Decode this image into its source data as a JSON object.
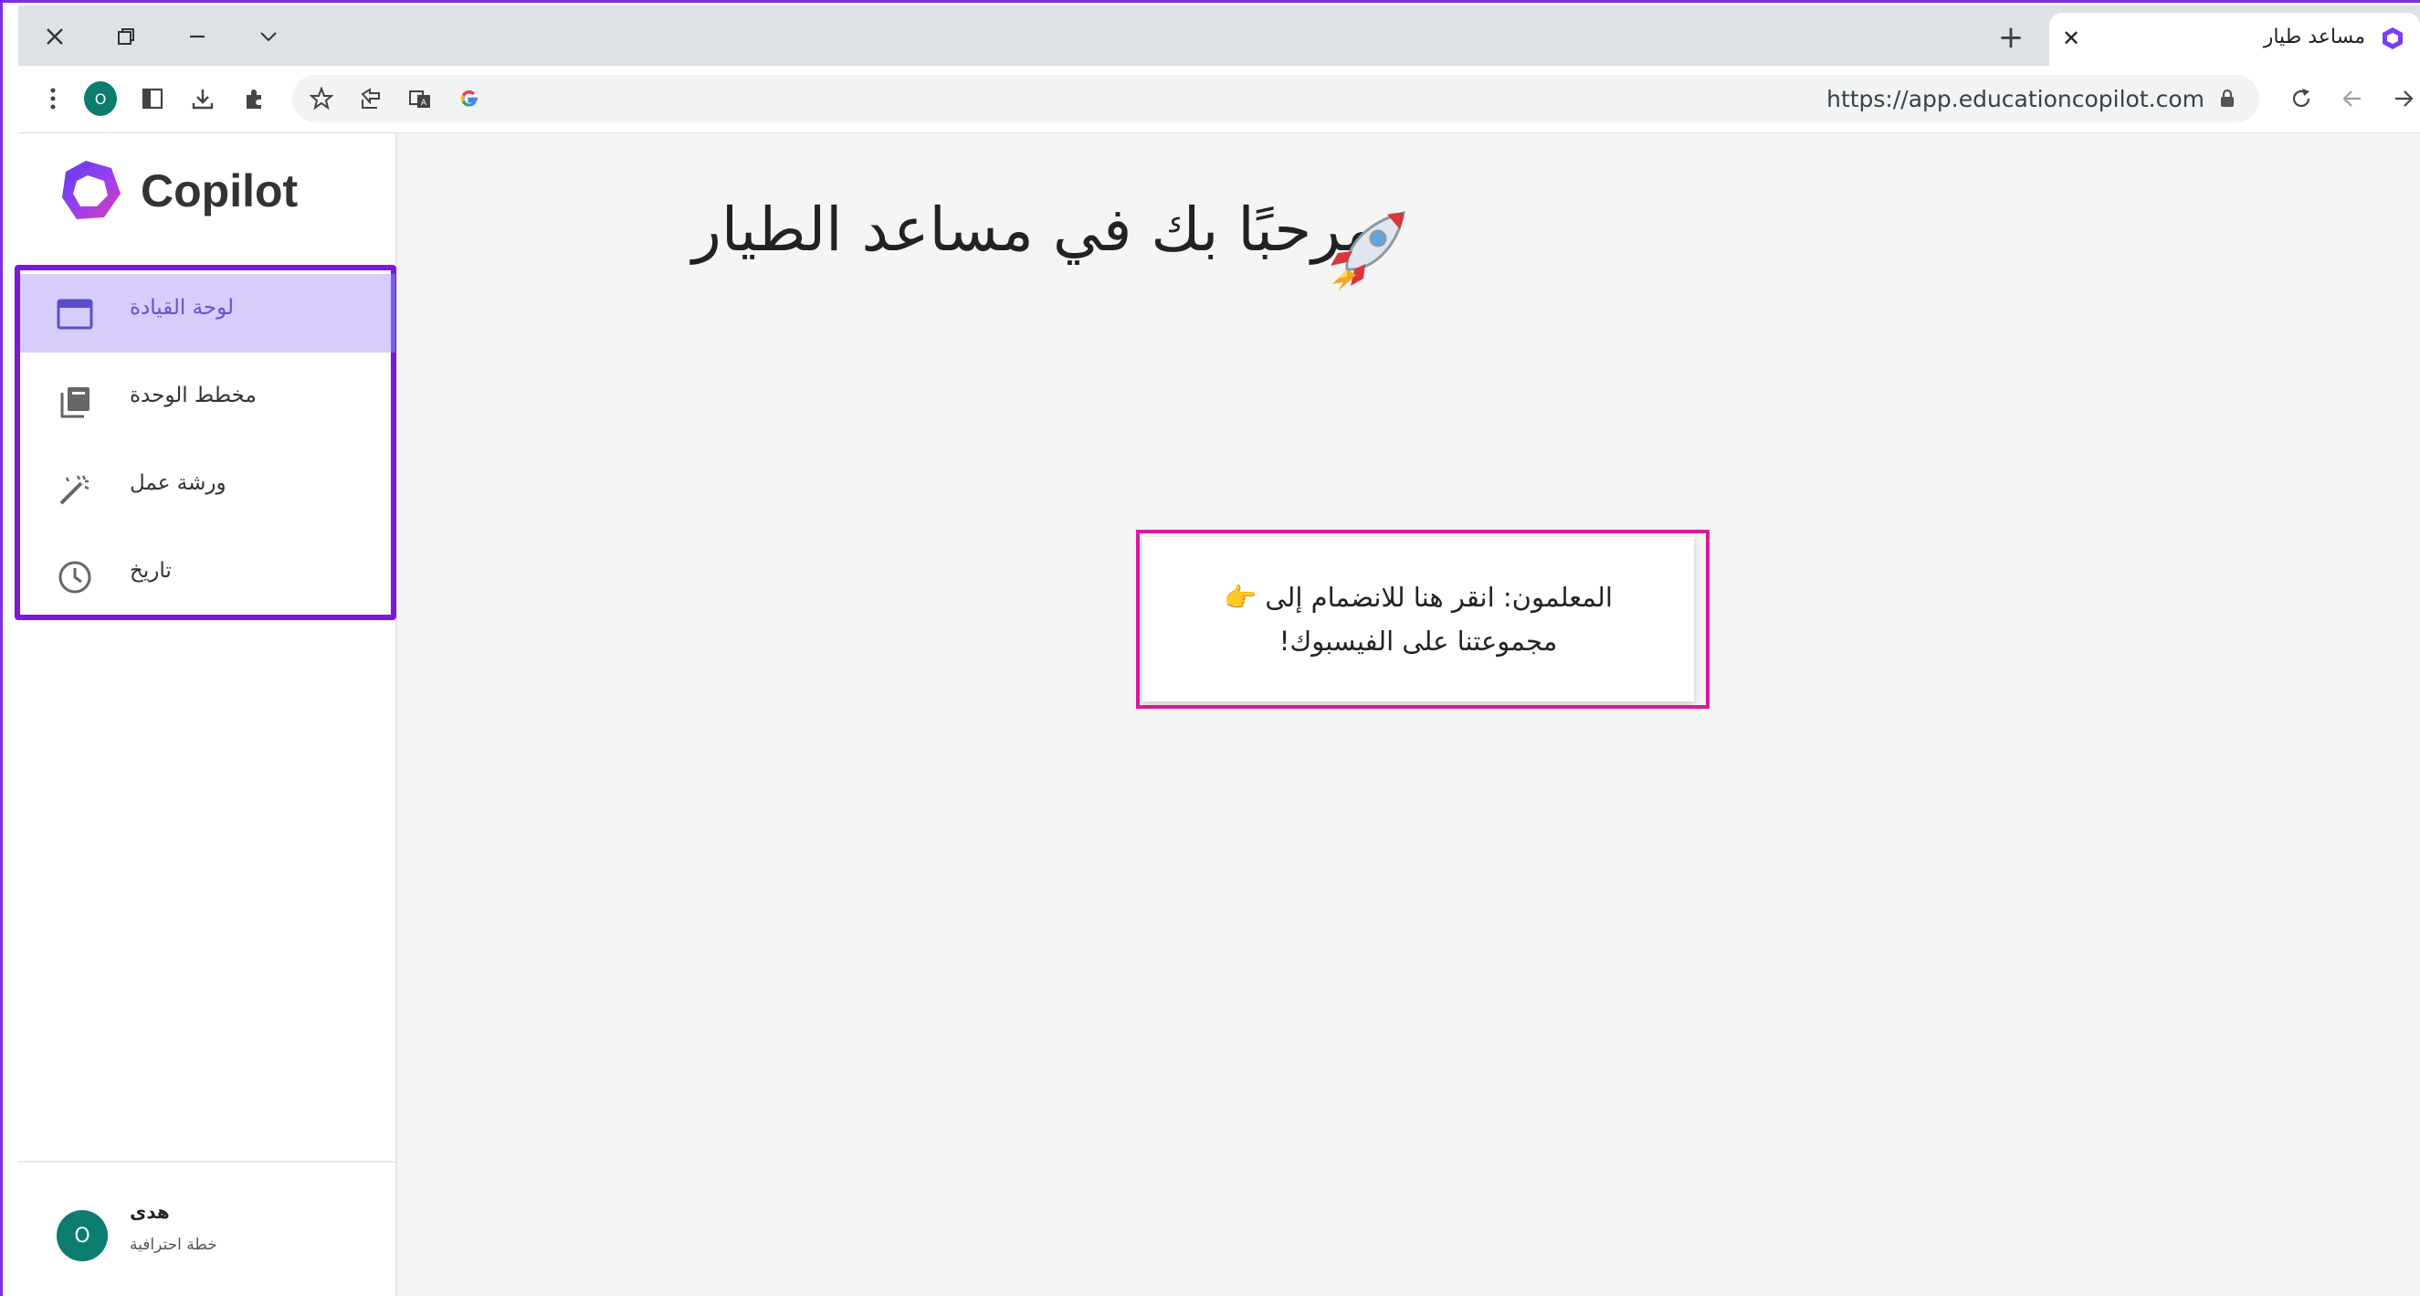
{
  "browser": {
    "tab_title": "مساعد طيار",
    "url": "https://app.educationcopilot.com",
    "profile_initial": "O"
  },
  "app": {
    "logo_text": "Copilot",
    "brand_color": "#7b5ce8"
  },
  "sidebar": {
    "items": [
      {
        "label": "لوحة القيادة",
        "icon": "dashboard-icon",
        "active": true
      },
      {
        "label": "مخطط الوحدة",
        "icon": "unit-planner-icon",
        "active": false
      },
      {
        "label": "ورشة عمل",
        "icon": "magic-wand-icon",
        "active": false
      },
      {
        "label": "تاريخ",
        "icon": "clock-icon",
        "active": false
      }
    ]
  },
  "user": {
    "initial": "O",
    "name": "هدى",
    "plan": "خطة احترافية"
  },
  "main": {
    "welcome": "مرحبًا بك في مساعد الطيار",
    "callout_line1": "المعلمون: انقر هنا للانضمام إلى 👉",
    "callout_line2": "مجموعتنا على الفيسبوك!"
  }
}
